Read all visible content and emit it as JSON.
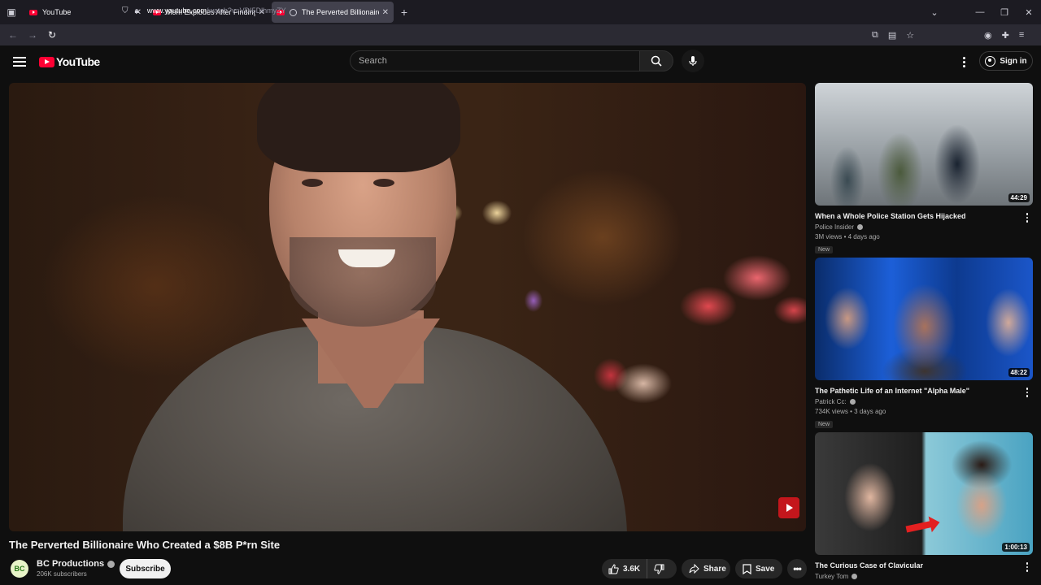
{
  "browser": {
    "tabs": [
      {
        "label": "YouTube",
        "active": false
      },
      {
        "label": "Mom Explodes After Finding O",
        "active": false
      },
      {
        "label": "The Perverted Billionaire W",
        "active": true
      }
    ],
    "new_tab": "+",
    "url_host": "www.youtube.com",
    "url_path": "/watch?v=VDI5DlhmyZY"
  },
  "youtube": {
    "logo_text": "YouTube",
    "search_placeholder": "Search",
    "signin_label": "Sign in"
  },
  "video": {
    "title": "The Perverted Billionaire Who Created a $8B P*rn Site",
    "channel": {
      "name": "BC Productions",
      "avatar_text": "BC",
      "subscribers": "206K subscribers",
      "verified": true
    },
    "subscribe_label": "Subscribe",
    "likes": "3.6K",
    "share_label": "Share",
    "save_label": "Save"
  },
  "recommendations": [
    {
      "title": "When a Whole Police Station Gets Hijacked",
      "channel": "Police Insider",
      "meta": "3M views • 4 days ago",
      "badge": "New",
      "duration": "44:29"
    },
    {
      "title": "The Pathetic Life of an Internet \"Alpha Male\"",
      "channel": "Patrick Cc:",
      "meta": "734K views • 3 days ago",
      "badge": "New",
      "duration": "48:22"
    },
    {
      "title": "The Curious Case of Clavicular",
      "channel": "Turkey Tom",
      "meta": "",
      "badge": "",
      "duration": "1:00:13"
    }
  ],
  "colors": {
    "brand_red": "#ff0033",
    "background": "#0f0f0f",
    "pill": "#272727"
  }
}
